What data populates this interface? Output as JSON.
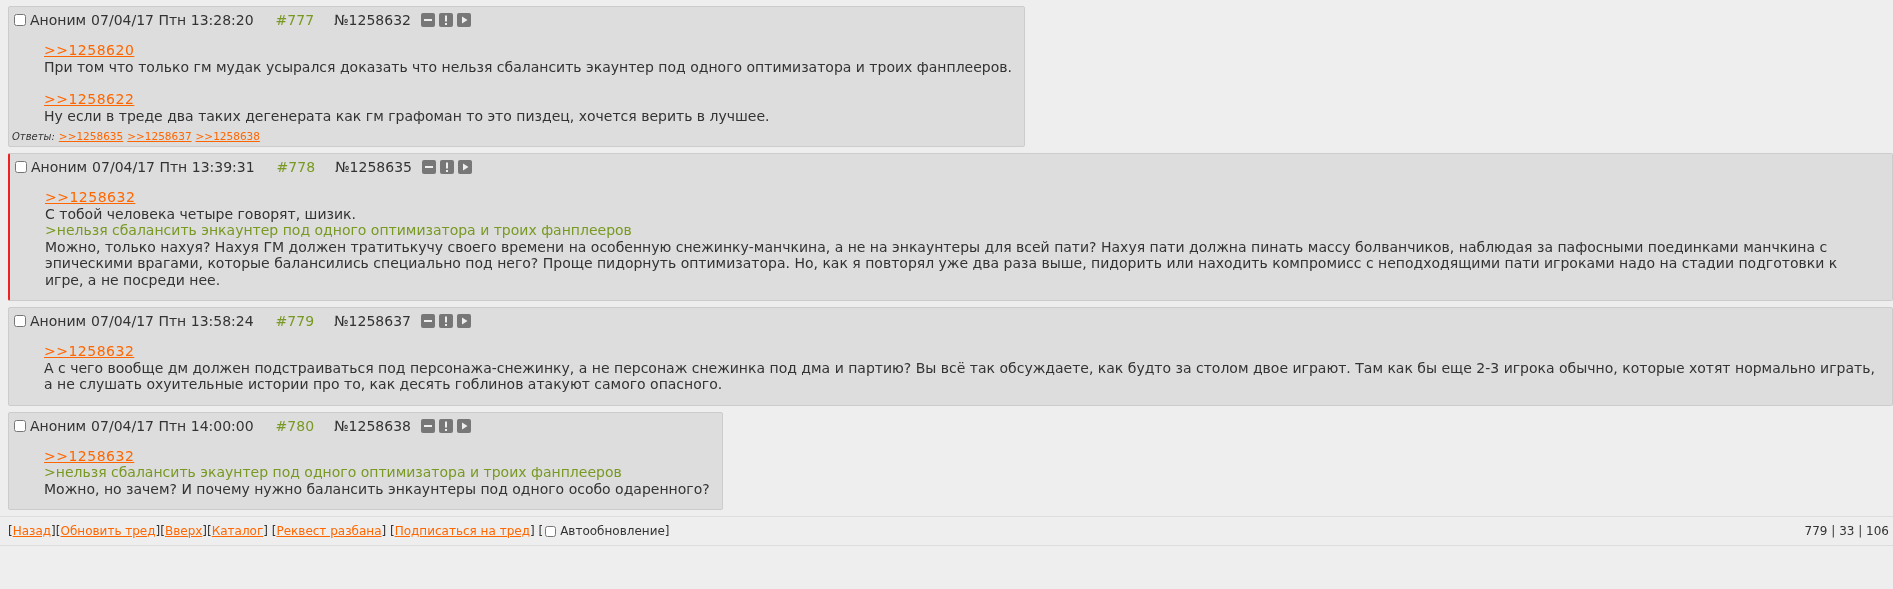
{
  "posts": [
    {
      "checked": false,
      "author": "Аноним",
      "date": "07/04/17 Птн 13:28:20",
      "num": "#777",
      "id": "№1258632",
      "highlighted": false,
      "paragraphs": [
        [
          {
            "kind": "link",
            "text": ">>1258620"
          },
          {
            "kind": "text",
            "text": "При том что только гм мудак усырался доказать что нельзя сбалансить экаунтер под одного оптимизатора и троих фанплееров."
          }
        ],
        [
          {
            "kind": "link",
            "text": ">>1258622"
          },
          {
            "kind": "text",
            "text": "Ну если в треде два таких дегенерата как гм графоман то это пиздец, хочется верить в лучшее."
          }
        ]
      ],
      "replies_label": "Ответы:",
      "replies": [
        ">>1258635",
        ">>1258637",
        ">>1258638"
      ]
    },
    {
      "checked": false,
      "author": "Аноним",
      "date": "07/04/17 Птн 13:39:31",
      "num": "#778",
      "id": "№1258635",
      "highlighted": true,
      "paragraphs": [
        [
          {
            "kind": "link",
            "text": ">>1258632"
          },
          {
            "kind": "text",
            "text": "С тобой человека четыре говорят, шизик."
          },
          {
            "kind": "quote",
            "text": ">нельзя сбалансить энкаунтер под одного оптимизатора и троих фанплееров"
          },
          {
            "kind": "text",
            "text": "Можно, только нахуя? Нахуя ГМ должен тратитькучу своего времени на особенную снежинку-манчкина, а не на энкаунтеры для всей пати? Нахуя пати должна пинать массу болванчиков, наблюдая за пафосными поединками манчкина с эпическими врагами, которые балансились специально под него? Проще пидорнуть оптимизатора. Но, как я повторял уже два раза выше, пидорить или находить компромисс с неподходящими пати игроками надо на стадии подготовки к игре, а не посреди нее."
          }
        ]
      ]
    },
    {
      "checked": false,
      "author": "Аноним",
      "date": "07/04/17 Птн 13:58:24",
      "num": "#779",
      "id": "№1258637",
      "highlighted": false,
      "paragraphs": [
        [
          {
            "kind": "link",
            "text": ">>1258632"
          },
          {
            "kind": "text",
            "text": "А с чего вообще дм должен подстраиваться под персонажа-снежинку, а не персонаж снежинка под дма и партию? Вы всё так обсуждаете, как будто за столом двое играют. Там как бы еще 2-3 игрока обычно, которые хотят нормально играть, а не слушать охуительные истории про то, как десять гоблинов атакуют самого опасного."
          }
        ]
      ]
    },
    {
      "checked": false,
      "author": "Аноним",
      "date": "07/04/17 Птн 14:00:00",
      "num": "#780",
      "id": "№1258638",
      "highlighted": false,
      "paragraphs": [
        [
          {
            "kind": "link",
            "text": ">>1258632"
          },
          {
            "kind": "quote",
            "text": ">нельзя сбалансить экаунтер под одного оптимизатора и троих фанплееров"
          },
          {
            "kind": "text",
            "text": "Можно, но зачем? И почему нужно балансить энкаунтеры под одного особо одаренного?"
          }
        ]
      ]
    }
  ],
  "nav": [
    {
      "kind": "bracket",
      "text": "["
    },
    {
      "kind": "link",
      "text": "Назад"
    },
    {
      "kind": "bracket",
      "text": "]["
    },
    {
      "kind": "link",
      "text": "Обновить тред"
    },
    {
      "kind": "bracket",
      "text": "]["
    },
    {
      "kind": "link",
      "text": "Вверх"
    },
    {
      "kind": "bracket",
      "text": "]["
    },
    {
      "kind": "link",
      "text": "Каталог"
    },
    {
      "kind": "bracket",
      "text": "] ["
    },
    {
      "kind": "link",
      "text": "Реквест разбана"
    },
    {
      "kind": "bracket",
      "text": "] ["
    },
    {
      "kind": "link",
      "text": "Подписаться на тред"
    },
    {
      "kind": "bracket",
      "text": "] ["
    },
    {
      "kind": "checkbox",
      "text": "Автообновление",
      "checked": false
    },
    {
      "kind": "bracket",
      "text": "]"
    }
  ],
  "stats": "779 | 33 | 106"
}
